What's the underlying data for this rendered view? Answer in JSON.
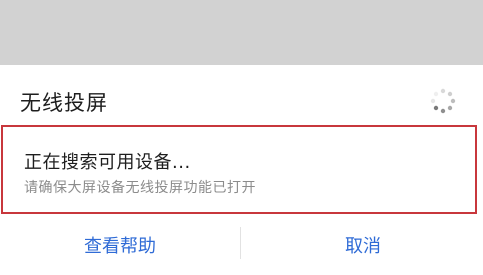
{
  "dialog": {
    "title": "无线投屏",
    "status": {
      "main_text": "正在搜索可用设备...",
      "hint_text": "请确保大屏设备无线投屏功能已打开"
    },
    "buttons": {
      "help_label": "查看帮助",
      "cancel_label": "取消"
    },
    "icons": {
      "loading": "loading-spinner-icon"
    },
    "colors": {
      "accent": "#2f6bd6",
      "highlight_border": "#c8373c",
      "backdrop": "#d2d2d2"
    }
  }
}
